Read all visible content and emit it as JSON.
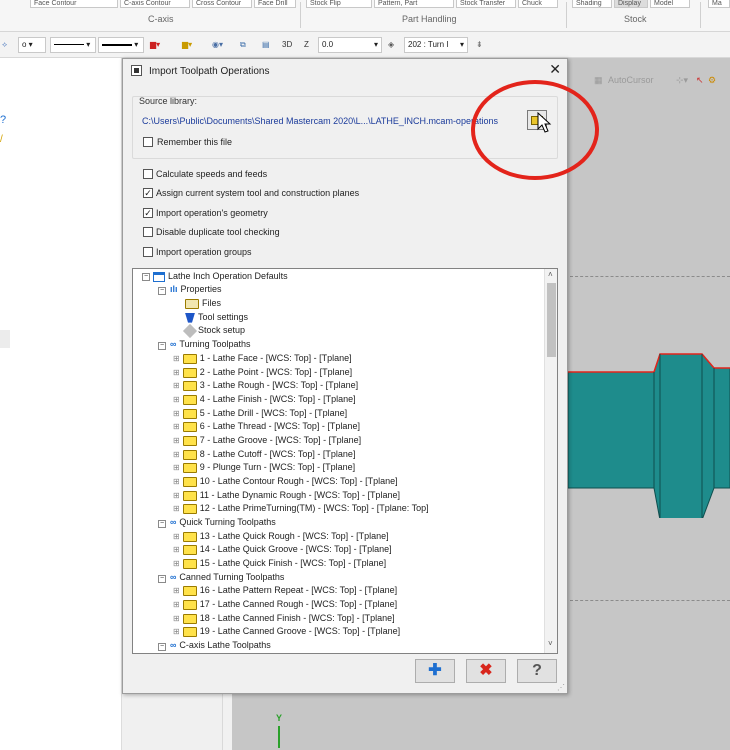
{
  "ribbon": {
    "top_items": [
      "Face Contour",
      "C-axis Contour",
      "Cross Contour",
      "Face Drill",
      "Stock Flip",
      "Pattern, Part",
      "Stock Transfer",
      "Chuck",
      "Shading",
      "Display",
      "Model",
      "Ma"
    ],
    "groups": {
      "caxis": "C-axis",
      "part_handling": "Part Handling",
      "stock": "Stock"
    }
  },
  "toolbar": {
    "view_3d": "3D",
    "z_label": "Z",
    "z_value": "0.0",
    "plane": "202 : Turn I"
  },
  "viewport": {
    "autocursor": "AutoCursor",
    "axis_y": "Y"
  },
  "dialog": {
    "title": "Import Toolpath Operations",
    "close": "✕",
    "source_library_label": "Source library:",
    "source_path": "C:\\Users\\Public\\Documents\\Shared Mastercam 2020\\L...\\LATHE_INCH.mcam-operations",
    "remember": {
      "label": "Remember this file",
      "checked": false
    },
    "options": [
      {
        "label": "Calculate speeds and feeds",
        "checked": false
      },
      {
        "label": "Assign current system tool and construction planes",
        "checked": true
      },
      {
        "label": "Import operation's geometry",
        "checked": true
      },
      {
        "label": "Disable duplicate tool checking",
        "checked": false
      },
      {
        "label": "Import operation groups",
        "checked": false
      }
    ],
    "tree": {
      "root": "Lathe Inch Operation Defaults",
      "properties": "Properties",
      "prop_children": [
        "Files",
        "Tool settings",
        "Stock setup"
      ],
      "groups": [
        {
          "name": "Turning Toolpaths",
          "items": [
            "1 - Lathe Face - [WCS: Top] - [Tplane]",
            "2 - Lathe Point - [WCS: Top] - [Tplane]",
            "3 - Lathe Rough - [WCS: Top] - [Tplane]",
            "4 - Lathe Finish - [WCS: Top] - [Tplane]",
            "5 - Lathe Drill - [WCS: Top] - [Tplane]",
            "6 - Lathe Thread - [WCS: Top] - [Tplane]",
            "7 - Lathe Groove - [WCS: Top] - [Tplane]",
            "8 - Lathe Cutoff - [WCS: Top] - [Tplane]",
            "9 - Plunge Turn - [WCS: Top] - [Tplane]",
            "10 - Lathe Contour Rough - [WCS: Top] - [Tplane]",
            "11 - Lathe Dynamic Rough - [WCS: Top] - [Tplane]",
            "12 - Lathe PrimeTurning(TM) - [WCS: Top] - [Tplane: Top]"
          ]
        },
        {
          "name": "Quick Turning Toolpaths",
          "items": [
            "13 - Lathe Quick Rough - [WCS: Top] - [Tplane]",
            "14 - Lathe Quick Groove - [WCS: Top] - [Tplane]",
            "15 - Lathe Quick Finish - [WCS: Top] - [Tplane]"
          ]
        },
        {
          "name": "Canned Turning Toolpaths",
          "items": [
            "16 - Lathe Pattern Repeat - [WCS: Top] - [Tplane]",
            "17 - Lathe Canned Rough - [WCS: Top] - [Tplane]",
            "18 - Lathe Canned Finish - [WCS: Top] - [Tplane]",
            "19 - Lathe Canned Groove - [WCS: Top] - [Tplane]"
          ]
        },
        {
          "name": "C-axis Lathe Toolpaths",
          "items": []
        }
      ]
    },
    "buttons": {
      "ok": "✚",
      "cancel": "✖",
      "help": "?"
    }
  },
  "colors": {
    "annotation": "#e3241b",
    "part": "#1e8c8c",
    "link": "#1b3b9b"
  }
}
